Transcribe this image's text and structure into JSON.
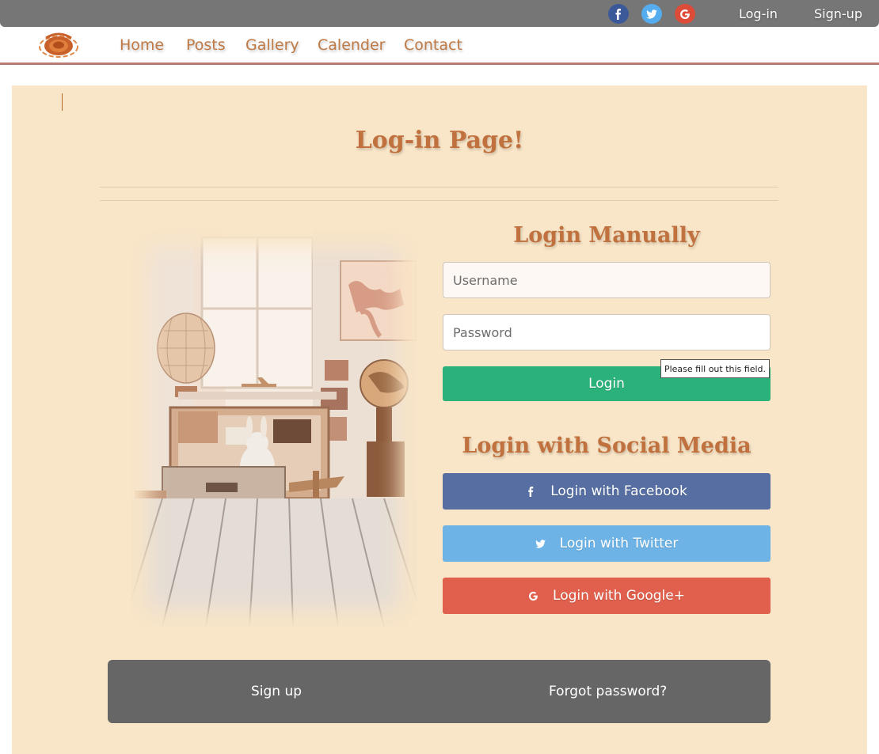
{
  "topbar": {
    "social_icons": [
      "facebook-icon",
      "twitter-icon",
      "google-icon"
    ],
    "login": "Log-in",
    "signup": "Sign-up"
  },
  "nav": {
    "items": [
      "Home",
      "Posts",
      "Gallery",
      "Calender",
      "Contact"
    ]
  },
  "page": {
    "title": "Log-in Page!"
  },
  "manual": {
    "title": "Login Manually",
    "username_placeholder": "Username",
    "password_placeholder": "Password",
    "login_button": "Login",
    "tooltip": "Please fill out this field."
  },
  "social": {
    "title": "Login with Social Media",
    "facebook": "Login with Facebook",
    "twitter": "Login with Twitter",
    "google": "Login with Google+"
  },
  "footer": {
    "signup": "Sign up",
    "forgot": "Forgot password?"
  },
  "colors": {
    "panel": "#f9e5c7",
    "accent": "#c0713d",
    "login": "#2bb27a",
    "facebook": "#566ea1",
    "twitter": "#6db3e6",
    "google": "#e0604d",
    "topbar": "#767676"
  }
}
